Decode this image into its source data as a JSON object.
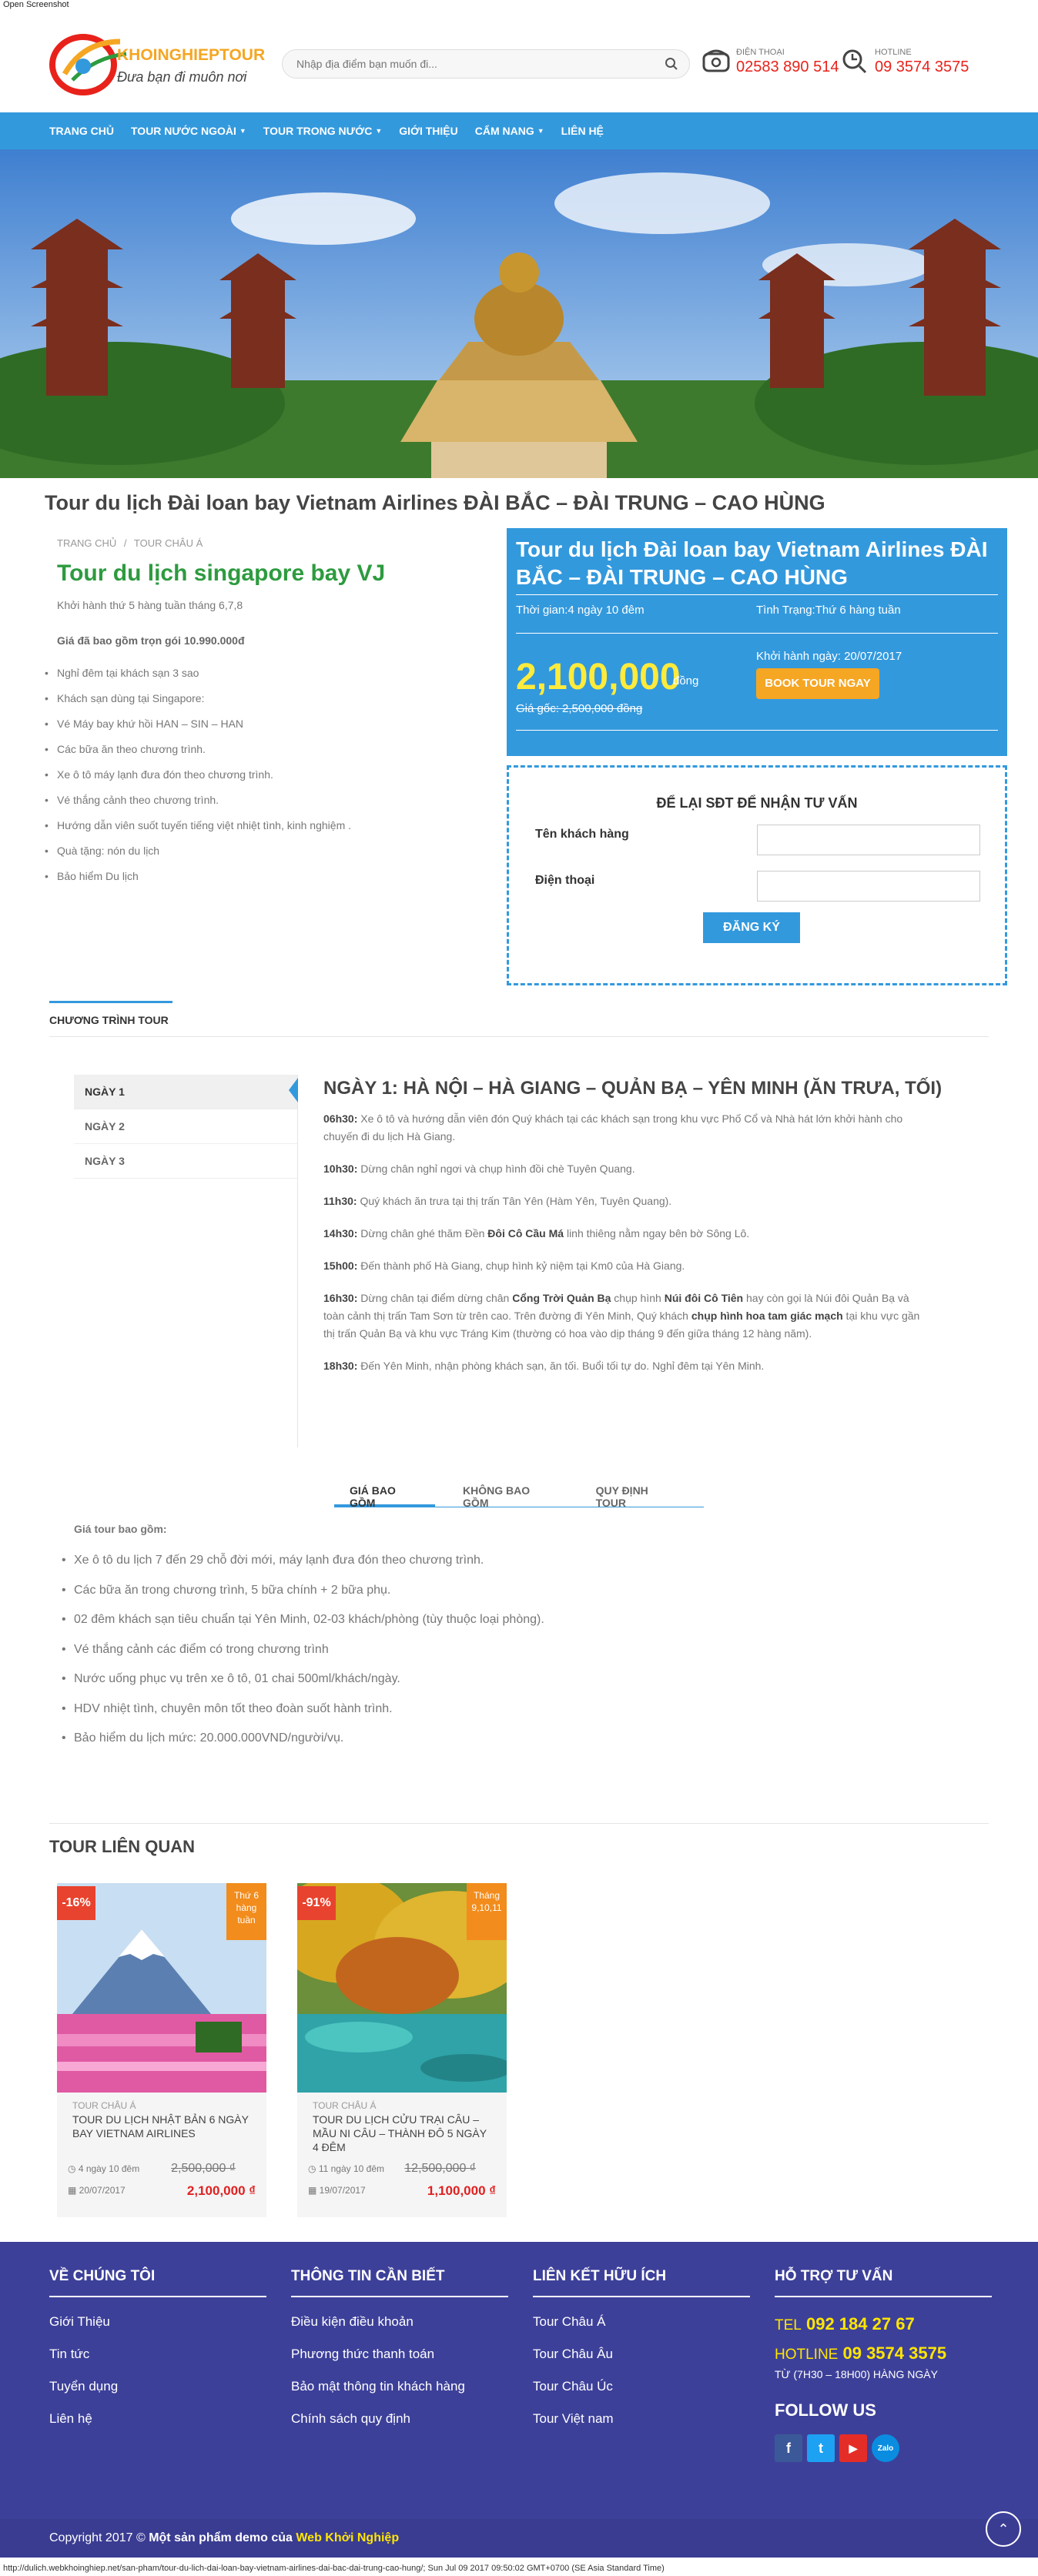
{
  "caption_top": "Open Screenshot",
  "logo": {
    "brand": "KHOINGHIEPTOUR",
    "slogan": "Đưa bạn đi muôn nơi"
  },
  "search": {
    "placeholder": "Nhập địa điểm bạn muốn đi..."
  },
  "phone": {
    "label": "ĐIỆN THOẠI",
    "number": "02583 890 514"
  },
  "hotline": {
    "label": "HOTLINE",
    "number": "09 3574 3575"
  },
  "nav": [
    {
      "label": "TRANG CHỦ",
      "dropdown": false
    },
    {
      "label": "TOUR NƯỚC NGOÀI",
      "dropdown": true
    },
    {
      "label": "TOUR TRONG NƯỚC",
      "dropdown": true
    },
    {
      "label": "GIỚI THIỆU",
      "dropdown": false
    },
    {
      "label": "CẨM NANG",
      "dropdown": true
    },
    {
      "label": "LIÊN HỆ",
      "dropdown": false
    }
  ],
  "page_title": "Tour du lịch Đài loan bay Vietnam Airlines ĐÀI BẮC – ĐÀI TRUNG – CAO HÙNG",
  "breadcrumb": [
    "TRANG CHỦ",
    "/",
    "TOUR CHÂU Á"
  ],
  "left": {
    "title": "Tour du lịch singapore bay VJ",
    "subtitle": "Khởi hành thứ 5 hàng tuần tháng 6,7,8",
    "price_note": "Giá đã bao gồm trọn gói 10.990.000đ",
    "items": [
      "Nghỉ đêm tại khách sạn 3 sao",
      "Khách sạn dùng tại Singapore:",
      "Vé Máy bay khứ hồi HAN – SIN – HAN",
      "Các bữa ăn theo chương trình.",
      "Xe ô tô máy lạnh đưa đón theo chương trình.",
      "Vé thắng cảnh theo chương trình.",
      "Hướng dẫn viên suốt tuyến tiếng việt nhiệt tình, kinh nghiệm .",
      "Quà tặng: nón du lịch",
      "Bảo hiểm Du lịch"
    ]
  },
  "bluebox": {
    "title": "Tour du lịch Đài loan bay Vietnam Airlines ĐÀI BẮC – ĐÀI TRUNG – CAO HÙNG",
    "time": "Thời gian:4 ngày 10 đêm",
    "status": "Tình Trạng:Thứ 6 hàng tuần",
    "price": "2,100,000",
    "unit": "đồng",
    "original": "Giá gốc: 2,500,000 đồng",
    "departure": "Khởi hành ngày: 20/07/2017",
    "book_label": "BOOK TOUR NGAY"
  },
  "form": {
    "title": "ĐỂ LẠI SĐT ĐỂ NHẬN TƯ VẤN",
    "name_label": "Tên khách hàng",
    "phone_label": "Điện thoại",
    "submit_label": "ĐĂNG KÝ"
  },
  "program_tab": "CHƯƠNG TRÌNH TOUR",
  "days": [
    "NGÀY 1",
    "NGÀY 2",
    "NGÀY 3"
  ],
  "day1": {
    "title": "NGÀY 1: HÀ NỘI – HÀ GIANG – QUẢN BẠ – YÊN MINH (ĂN TRƯA, TỐI)",
    "entries": [
      {
        "time": "06h30:",
        "text": " Xe ô tô và hướng dẫn viên đón Quý khách tại các khách sạn trong khu vực Phố Cổ và Nhà hát lớn khởi hành cho chuyến đi du lịch Hà Giang."
      },
      {
        "time": "10h30:",
        "text": " Dừng chân nghỉ ngơi và chụp hình đồi chè Tuyên Quang."
      },
      {
        "time": "11h30:",
        "text": " Quý khách ăn trưa tại thị trấn Tân Yên (Hàm Yên, Tuyên Quang)."
      },
      {
        "time": "14h30:",
        "text_a": " Dừng chân ghé thăm Đền ",
        "bold": "Đôi Cô Cầu Má",
        "text_b": " linh thiêng nằm ngay bên bờ Sông Lô."
      },
      {
        "time": "15h00:",
        "text": " Đến thành phố Hà Giang, chụp hình kỷ niệm tại Km0 của Hà Giang."
      },
      {
        "time": "16h30:",
        "t1": " Dừng chân tại điểm dừng chân ",
        "b1": "Cổng Trời Quản Bạ",
        "t2": " chụp hình ",
        "b2": "Núi đôi Cô Tiên",
        "t3": " hay còn gọi là Núi đôi Quản Bạ và toàn cảnh thị trấn Tam Sơn từ trên cao. Trên đường đi Yên Minh, Quý khách ",
        "b3": "chụp hình hoa tam giác mạch",
        "t4": " tại khu vực gần thị trấn Quản Bạ và khu vực Tráng Kim (thường có hoa vào dịp tháng 9 đến giữa tháng 12 hàng năm)."
      },
      {
        "time": "18h30:",
        "text": " Đến Yên Minh, nhận phòng khách sạn, ăn tối. Buổi tối tự do. Nghỉ đêm tại Yên Minh."
      }
    ]
  },
  "price_tabs": [
    "GIÁ BAO GỒM",
    "KHÔNG BAO GỒM",
    "QUY ĐỊNH TOUR"
  ],
  "included": {
    "heading": "Giá tour bao gồm:",
    "items": [
      "Xe ô tô du lịch 7 đến 29 chỗ đời mới, máy lạnh đưa đón theo chương trình.",
      "Các bữa ăn trong chương trình, 5 bữa chính + 2 bữa phụ.",
      "02 đêm khách sạn tiêu chuẩn tại Yên Minh, 02-03 khách/phòng (tùy thuộc loại phòng).",
      "Vé thắng cảnh các điểm có trong chương trình",
      "Nước uống phục vụ trên xe ô tô, 01 chai 500ml/khách/ngày.",
      "HDV nhiệt tình, chuyên môn tốt theo đoàn suốt hành trình.",
      "Bảo hiểm du lịch mức: 20.000.000VND/người/vụ."
    ]
  },
  "related": {
    "title": "TOUR LIÊN QUAN",
    "cards": [
      {
        "discount": "-16%",
        "tag": "Thứ 6 hàng tuần",
        "category": "TOUR CHÂU Á",
        "name": "TOUR DU LỊCH NHẬT BẢN 6 NGÀY BAY VIETNAM AIRLINES",
        "duration": "4 ngày 10 đêm",
        "date": "20/07/2017",
        "old_price": "2,500,000 ₫",
        "price": "2,100,000 ₫"
      },
      {
        "discount": "-91%",
        "tag": "Tháng 9,10,11",
        "category": "TOUR CHÂU Á",
        "name": "TOUR DU LỊCH CỬU TRẠI CÂU – MẦU NI CÂU – THÀNH ĐÔ 5 NGÀY 4 ĐÊM",
        "duration": "11 ngày 10 đêm",
        "date": "19/07/2017",
        "old_price": "12,500,000 ₫",
        "price": "1,100,000 ₫"
      }
    ]
  },
  "footer": {
    "col1": {
      "title": "VỀ CHÚNG TÔI",
      "links": [
        "Giới Thiệu",
        "Tin tức",
        "Tuyển dụng",
        "Liên hệ"
      ]
    },
    "col2": {
      "title": "THÔNG TIN CẦN BIẾT",
      "links": [
        "Điều kiện điều khoản",
        "Phương thức thanh toán",
        "Bảo mật thông tin khách hàng",
        "Chính sách quy định"
      ]
    },
    "col3": {
      "title": "LIÊN KẾT HỮU ÍCH",
      "links": [
        "Tour Châu Á",
        "Tour Châu Âu",
        "Tour Châu Úc",
        "Tour Việt nam"
      ]
    },
    "col4": {
      "title": "HỖ TRỢ TƯ VẤN",
      "tel_label": "TEL",
      "tel": "092 184 27 67",
      "hot_label": "HOTLINE",
      "hot": "09 3574 3575",
      "hours": "TỪ (7H30 – 18H00) HÀNG NGÀY",
      "follow": "FOLLOW US",
      "social": [
        "f",
        "t",
        "▶",
        "Zalo"
      ]
    },
    "copyright_prefix": "Copyright 2017 © ",
    "copyright_b1": "Một sản phẩm demo của",
    "copyright_b2": " Web Khởi Nghiệp"
  },
  "caption_bottom": "http://dulich.webkhoinghiep.net/san-pham/tour-du-lich-dai-loan-bay-vietnam-airlines-dai-bac-dai-trung-cao-hung/; Sun Jul 09 2017 09:50:02 GMT+0700 (SE Asia Standard Time)",
  "colors": {
    "brand_blue": "#3399dd",
    "green_title": "#2d9b3f",
    "price_yellow": "#ffeb3b",
    "book_orange": "#f5a623",
    "footer_bg": "#3d4099",
    "hot_red": "#e8221b"
  }
}
